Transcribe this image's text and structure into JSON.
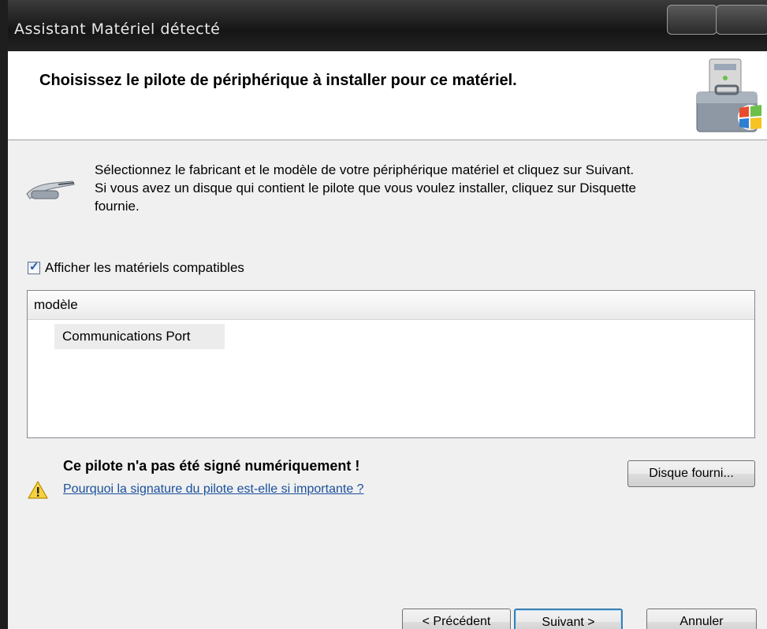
{
  "window": {
    "title": "Assistant Matériel détecté"
  },
  "header": {
    "title": "Choisissez le pilote de périphérique à installer pour ce matériel."
  },
  "intro": {
    "line1": "Sélectionnez le fabricant et le modèle de votre périphérique matériel et cliquez sur Suivant.",
    "line2": "Si vous avez un disque qui contient le pilote que vous voulez installer, cliquez sur Disquette",
    "line3": "fournie."
  },
  "compat": {
    "label": "Afficher les matériels compatibles",
    "checked": true
  },
  "list": {
    "column_header": "modèle",
    "items": [
      {
        "label": "Communications Port",
        "selected": true
      }
    ]
  },
  "warning": {
    "text": "Ce pilote n'a pas été signé numériquement !",
    "link": "Pourquoi la signature du pilote est-elle si importante ?"
  },
  "buttons": {
    "disk": "Disque fourni...",
    "previous": "< Précédent",
    "next": "Suivant >",
    "cancel": "Annuler"
  },
  "colors": {
    "link": "#1a4f9c",
    "titlebar": "#1e1e1e",
    "default_button_border": "#3c7fb1"
  }
}
